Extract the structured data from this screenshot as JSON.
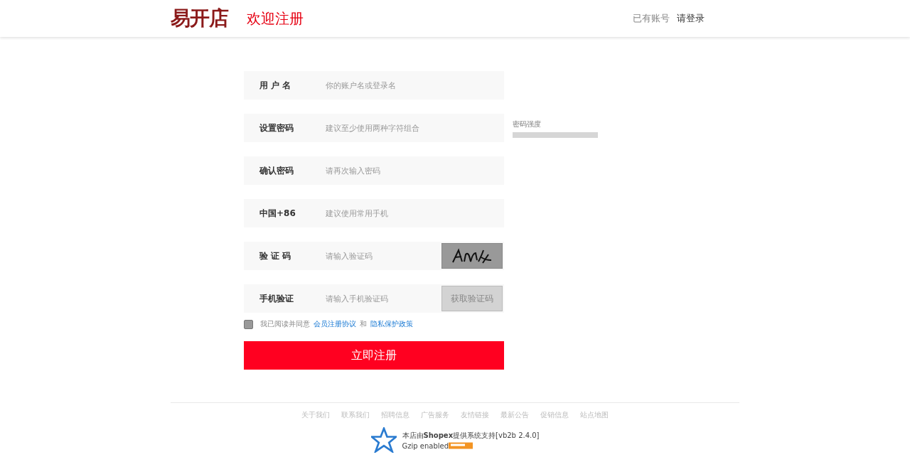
{
  "header": {
    "logo": "易开店",
    "title": "欢迎注册",
    "login_prompt": "已有账号",
    "login_link": "请登录"
  },
  "form": {
    "fields": [
      {
        "kind": "text",
        "label": "用 户 名",
        "placeholder": "你的账户名或登录名"
      },
      {
        "kind": "password",
        "label": "设置密码",
        "placeholder": "建议至少使用两种字符组合",
        "strength": {
          "label": "密码强度",
          "level": 0
        }
      },
      {
        "kind": "password",
        "label": "确认密码",
        "placeholder": "请再次输入密码"
      },
      {
        "kind": "text",
        "label": "中国+86",
        "placeholder": "建议使用常用手机"
      },
      {
        "kind": "captcha",
        "label": "验 证 码",
        "placeholder": "请输入验证码"
      },
      {
        "kind": "sms",
        "label": "手机验证",
        "placeholder": "请输入手机验证码",
        "button": "获取验证码",
        "disabled": true
      }
    ],
    "agreement": {
      "checked": false,
      "text": "我已阅读并同意",
      "link_1": "会员注册协议",
      "joiner": "和",
      "link_2": "隐私保护政策"
    },
    "submit": "立即注册"
  },
  "footer": {
    "links": [
      "关于我们",
      "联系我们",
      "招聘信息",
      "广告服务",
      "友情链接",
      "最新公告",
      "促销信息",
      "站点地图"
    ],
    "credit": "本店由**Shopex**提供系统支持[vb2b 2.4.0]",
    "gzip": "Gzip enabled"
  }
}
